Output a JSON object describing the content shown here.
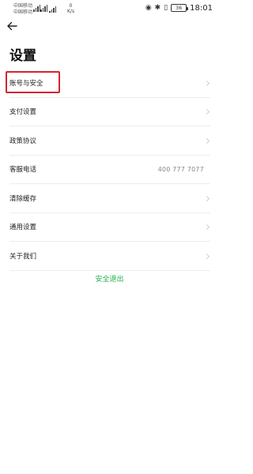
{
  "status_bar": {
    "carrier_1": "中国移动",
    "carrier_2": "中国移动",
    "net_speed_value": "0",
    "net_speed_unit": "K/s",
    "battery": "36",
    "time": "18:01"
  },
  "header": {
    "title": "设置"
  },
  "settings": {
    "items": [
      {
        "label": "账号与安全"
      },
      {
        "label": "支付设置"
      },
      {
        "label": "政策协议"
      },
      {
        "label": "客服电话",
        "value": "400 777 7077"
      },
      {
        "label": "清除缓存"
      },
      {
        "label": "通用设置"
      },
      {
        "label": "关于我们"
      }
    ]
  },
  "logout": {
    "label": "安全退出",
    "color": "#1fb24a"
  },
  "colors": {
    "highlight": "#d42532",
    "divider": "#ededed"
  }
}
